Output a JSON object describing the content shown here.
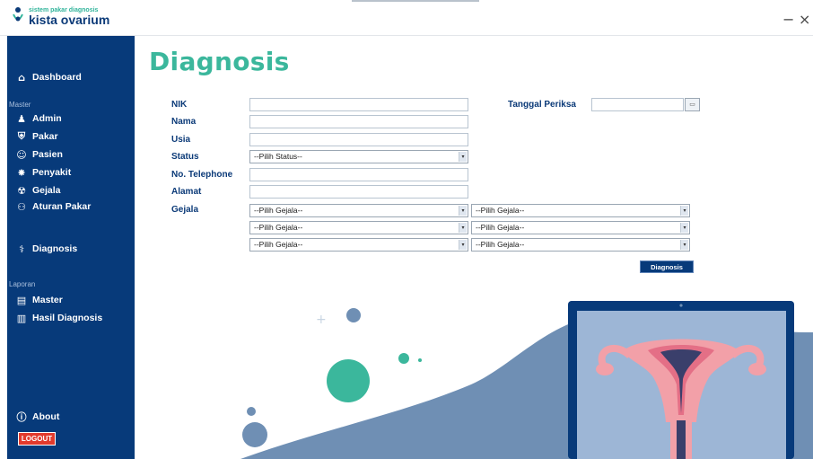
{
  "app": {
    "logo_small": "sistem pakar diagnosis",
    "logo_big": "kista ovarium",
    "minimize_icon": "−",
    "close_icon": "×"
  },
  "sidebar": {
    "dashboard": "Dashboard",
    "master_section": "Master",
    "master_items": [
      "Admin",
      "Pakar",
      "Pasien",
      "Penyakit",
      "Gejala",
      "Aturan Pakar"
    ],
    "diagnosis": "Diagnosis",
    "laporan_section": "Laporan",
    "laporan_items": [
      "Master",
      "Hasil Diagnosis"
    ],
    "about": "About",
    "logout": "LOGOUT"
  },
  "page": {
    "title": "Diagnosis"
  },
  "form": {
    "labels": {
      "nik": "NIK",
      "nama": "Nama",
      "usia": "Usia",
      "status": "Status",
      "telephone": "No. Telephone",
      "alamat": "Alamat",
      "gejala": "Gejala",
      "tanggal": "Tanggal Periksa"
    },
    "values": {
      "nik": "",
      "nama": "",
      "usia": "",
      "telephone": "",
      "alamat": "",
      "tanggal": ""
    },
    "status_selected": "--Pilih Status--",
    "gejala_selects": [
      "--Pilih Gejala--",
      "--Pilih Gejala--",
      "--Pilih Gejala--",
      "--Pilih Gejala--",
      "--Pilih Gejala--",
      "--Pilih Gejala--"
    ],
    "diagnosis_button": "Diagnosis"
  },
  "colors": {
    "sidebar_bg": "#073a7a",
    "title_green": "#3bb79c",
    "logout_red": "#e23a2c",
    "wave_blue": "#6f8fb4"
  }
}
